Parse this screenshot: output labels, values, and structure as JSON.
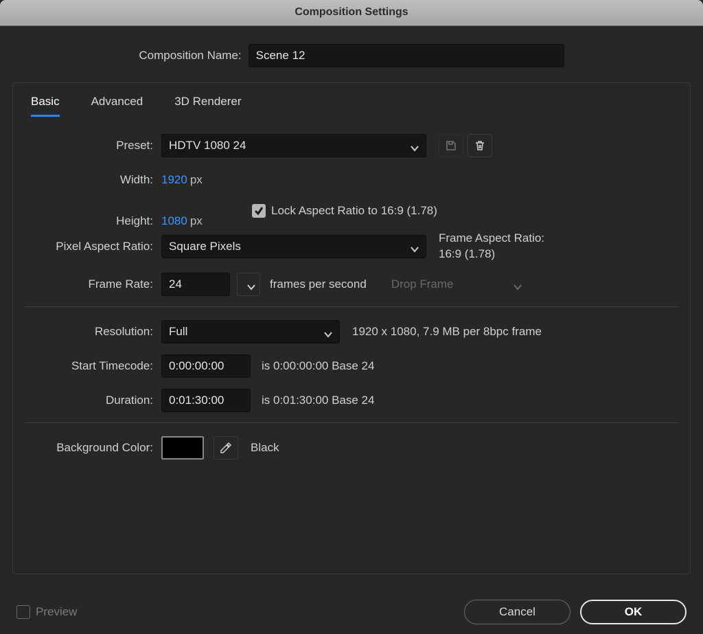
{
  "dialog": {
    "title": "Composition Settings",
    "name_label": "Composition Name:",
    "name_value": "Scene 12"
  },
  "tabs": {
    "basic": "Basic",
    "advanced": "Advanced",
    "renderer": "3D Renderer"
  },
  "preset": {
    "label": "Preset:",
    "value": "HDTV 1080 24"
  },
  "dimensions": {
    "width_label": "Width:",
    "width_value": "1920",
    "height_label": "Height:",
    "height_value": "1080",
    "unit": "px",
    "lock_label": "Lock Aspect Ratio to 16:9 (1.78)"
  },
  "par": {
    "label": "Pixel Aspect Ratio:",
    "value": "Square Pixels",
    "frame_aspect_label": "Frame Aspect Ratio:",
    "frame_aspect_value": "16:9 (1.78)"
  },
  "framerate": {
    "label": "Frame Rate:",
    "value": "24",
    "suffix": "frames per second",
    "drop": "Drop Frame"
  },
  "resolution": {
    "label": "Resolution:",
    "value": "Full",
    "info": "1920 x 1080, 7.9 MB per 8bpc frame"
  },
  "start": {
    "label": "Start Timecode:",
    "value": "0:00:00:00",
    "info": "is 0:00:00:00  Base 24"
  },
  "duration": {
    "label": "Duration:",
    "value": "0:01:30:00",
    "info": "is 0:01:30:00  Base 24"
  },
  "bg": {
    "label": "Background Color:",
    "name": "Black",
    "swatch": "#000000"
  },
  "footer": {
    "preview": "Preview",
    "cancel": "Cancel",
    "ok": "OK"
  }
}
